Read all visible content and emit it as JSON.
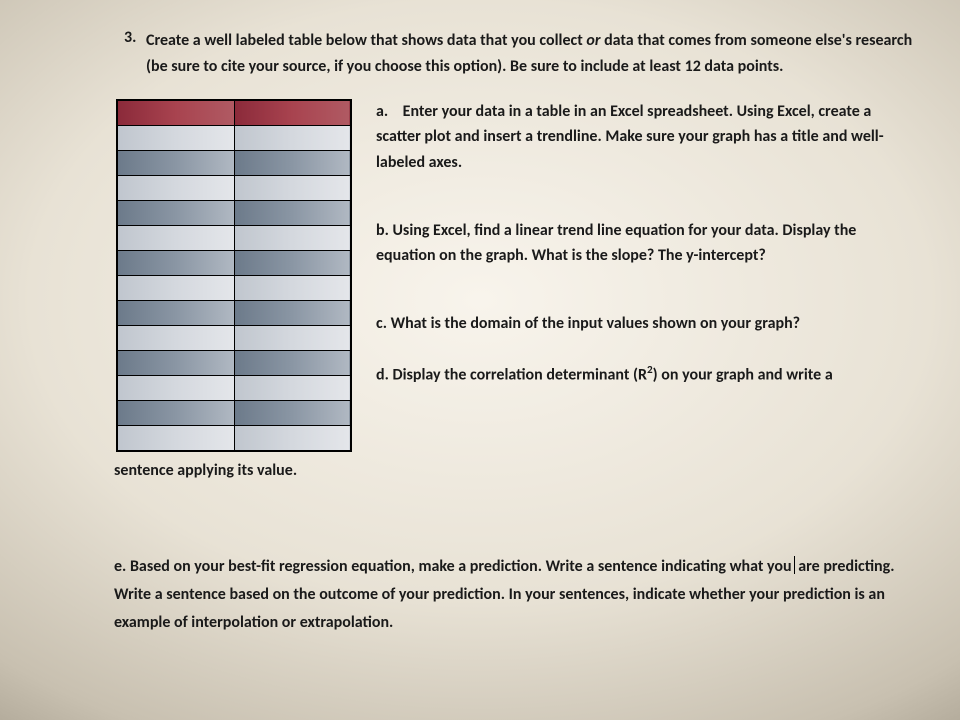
{
  "question_number": "3.",
  "prompt_segments": {
    "p1": "Create a ",
    "bold": "well labeled",
    "p2": " table below that shows data that you collect ",
    "or": "or",
    "p3": " data that comes from someone else's research (be sure to cite your source, if you choose this option). Be sure to include at least 12 data points."
  },
  "table": {
    "rows": 14,
    "cols": 2
  },
  "items": {
    "a": {
      "letter": "a.",
      "text": "Enter your data in a table in an Excel spreadsheet. Using Excel, create a scatter plot and insert a trendline.  Make sure your graph has a title and well-labeled axes."
    },
    "b": {
      "letter": "b.",
      "text": "Using Excel, find a linear trend line equation for your data. Display the equation on the graph.  What is the slope? The y-intercept?"
    },
    "c": {
      "letter": "c.",
      "text": "What is the domain of the input values shown on your graph?"
    },
    "d": {
      "letter": "d.",
      "lead": "Display the correlation determinant (R",
      "sup": "2",
      "tail": ") on your graph and write a",
      "continuation": "sentence applying its value."
    },
    "e": {
      "letter": "e.",
      "text": "Based on your best-fit regression equation, make a prediction. Write a sentence indicating what you",
      "text2": "are predicting. Write a sentence based on the outcome of your prediction. In your sentences, indicate whether your prediction is an example of interpolation or extrapolation."
    }
  }
}
